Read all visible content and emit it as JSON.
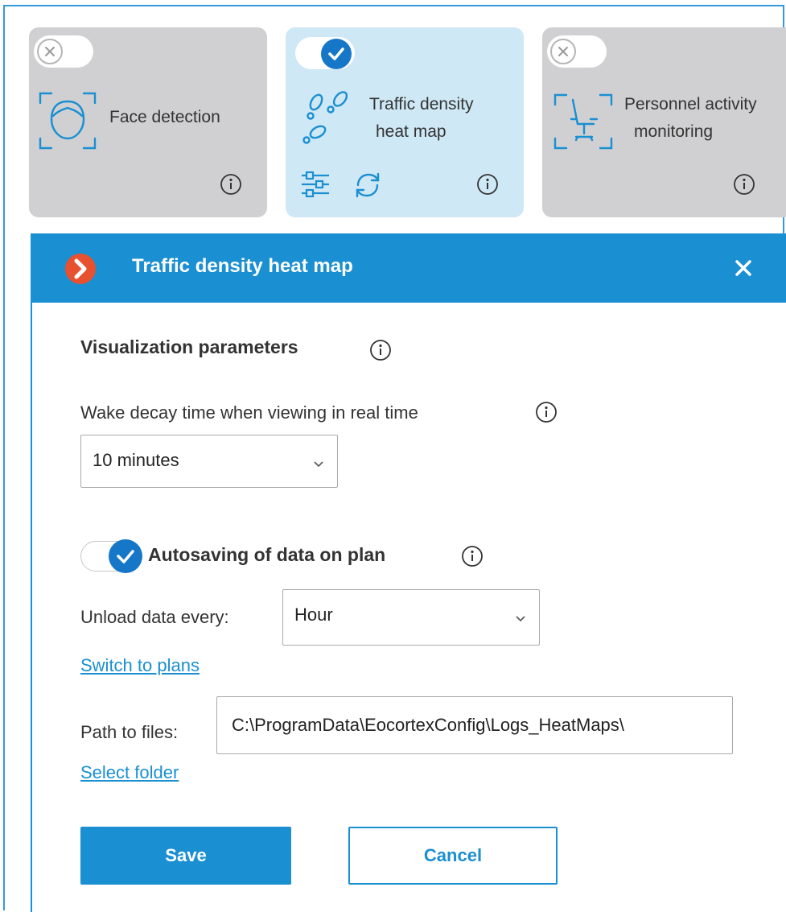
{
  "modules": [
    {
      "label": "Face detection",
      "enabled": false,
      "icon": "face-icon"
    },
    {
      "label_lines": [
        "Traffic density",
        "heat map"
      ],
      "enabled": true,
      "icon": "footprints-icon"
    },
    {
      "label_lines": [
        "Personnel activity",
        "monitoring"
      ],
      "enabled": false,
      "icon": "office-chair-icon"
    }
  ],
  "dialog": {
    "title": "Traffic density heat map",
    "section_title": "Visualization parameters",
    "decay_label": "Wake decay time when viewing in real time",
    "decay_value": "10 minutes",
    "autosave_label": "Autosaving of data on plan",
    "autosave_enabled": true,
    "unload_label": "Unload data every:",
    "unload_value": "Hour",
    "switch_link": "Switch to plans",
    "path_label": "Path to files:",
    "path_value": "C:\\ProgramData\\EocortexConfig\\Logs_HeatMaps\\",
    "select_folder_link": "Select folder",
    "save_label": "Save",
    "cancel_label": "Cancel"
  },
  "colors": {
    "accent": "#1a8fd2",
    "tile_off": "#d0d0d2",
    "tile_on": "#cfe8f5",
    "brand_orange": "#e8512f"
  }
}
